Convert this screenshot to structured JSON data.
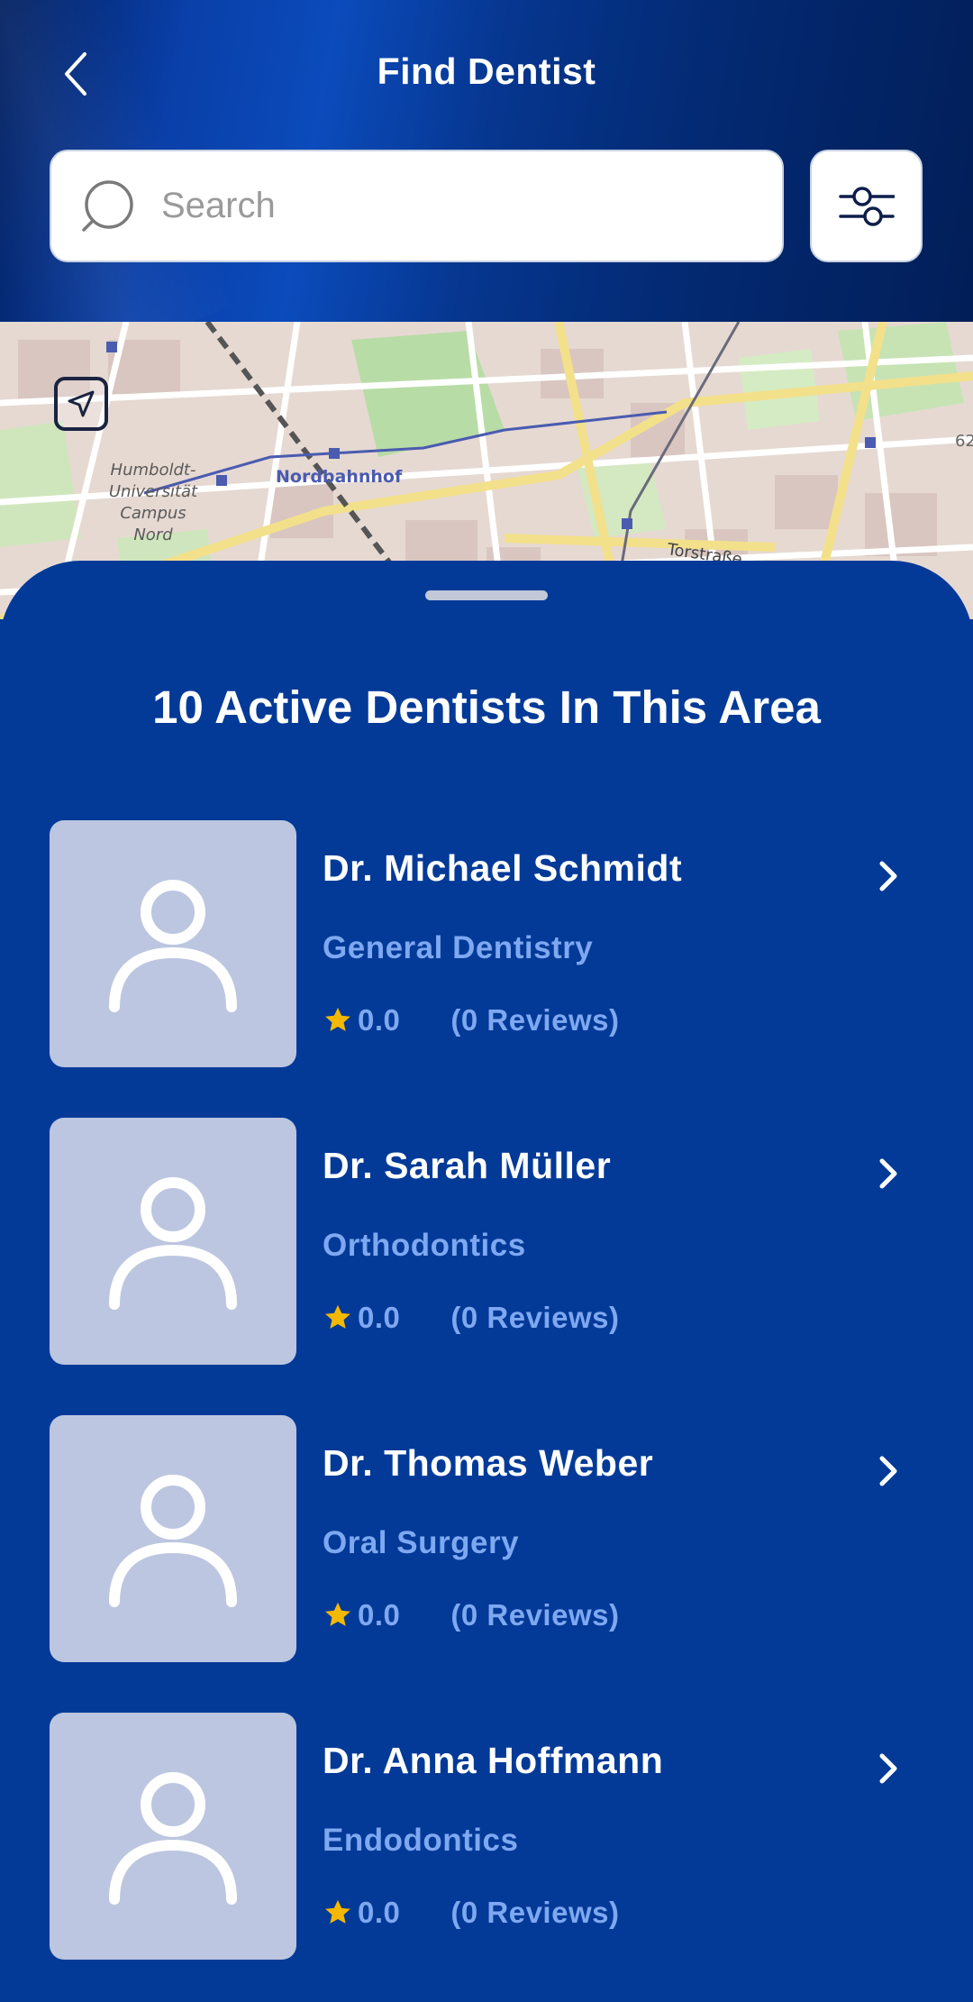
{
  "header": {
    "title": "Find Dentist",
    "back_icon": "chevron-left-icon",
    "filter_icon": "sliders-icon"
  },
  "search": {
    "placeholder": "Search",
    "value": ""
  },
  "map": {
    "labels": {
      "station": "Nordbahnhof",
      "campus": [
        "Humboldt-",
        "Universität",
        "Campus",
        "Nord"
      ],
      "street": "Torstraße",
      "edge_number": "62"
    },
    "locate_icon": "navigation-arrow-icon"
  },
  "sheet": {
    "title": "10 Active Dentists In This Area"
  },
  "dentists": [
    {
      "name": "Dr. Michael Schmidt",
      "specialty": "General Dentistry",
      "rating": "0.0",
      "reviews": "(0 Reviews)"
    },
    {
      "name": "Dr. Sarah Müller",
      "specialty": "Orthodontics",
      "rating": "0.0",
      "reviews": "(0 Reviews)"
    },
    {
      "name": "Dr. Thomas Weber",
      "specialty": "Oral Surgery",
      "rating": "0.0",
      "reviews": "(0 Reviews)"
    },
    {
      "name": "Dr. Anna Hoffmann",
      "specialty": "Endodontics",
      "rating": "0.0",
      "reviews": "(0 Reviews)"
    }
  ],
  "colors": {
    "sheet_bg": "#033a98",
    "accent_text": "#7ea8f0",
    "star": "#f5b800",
    "avatar_bg": "#bcc6e0"
  }
}
